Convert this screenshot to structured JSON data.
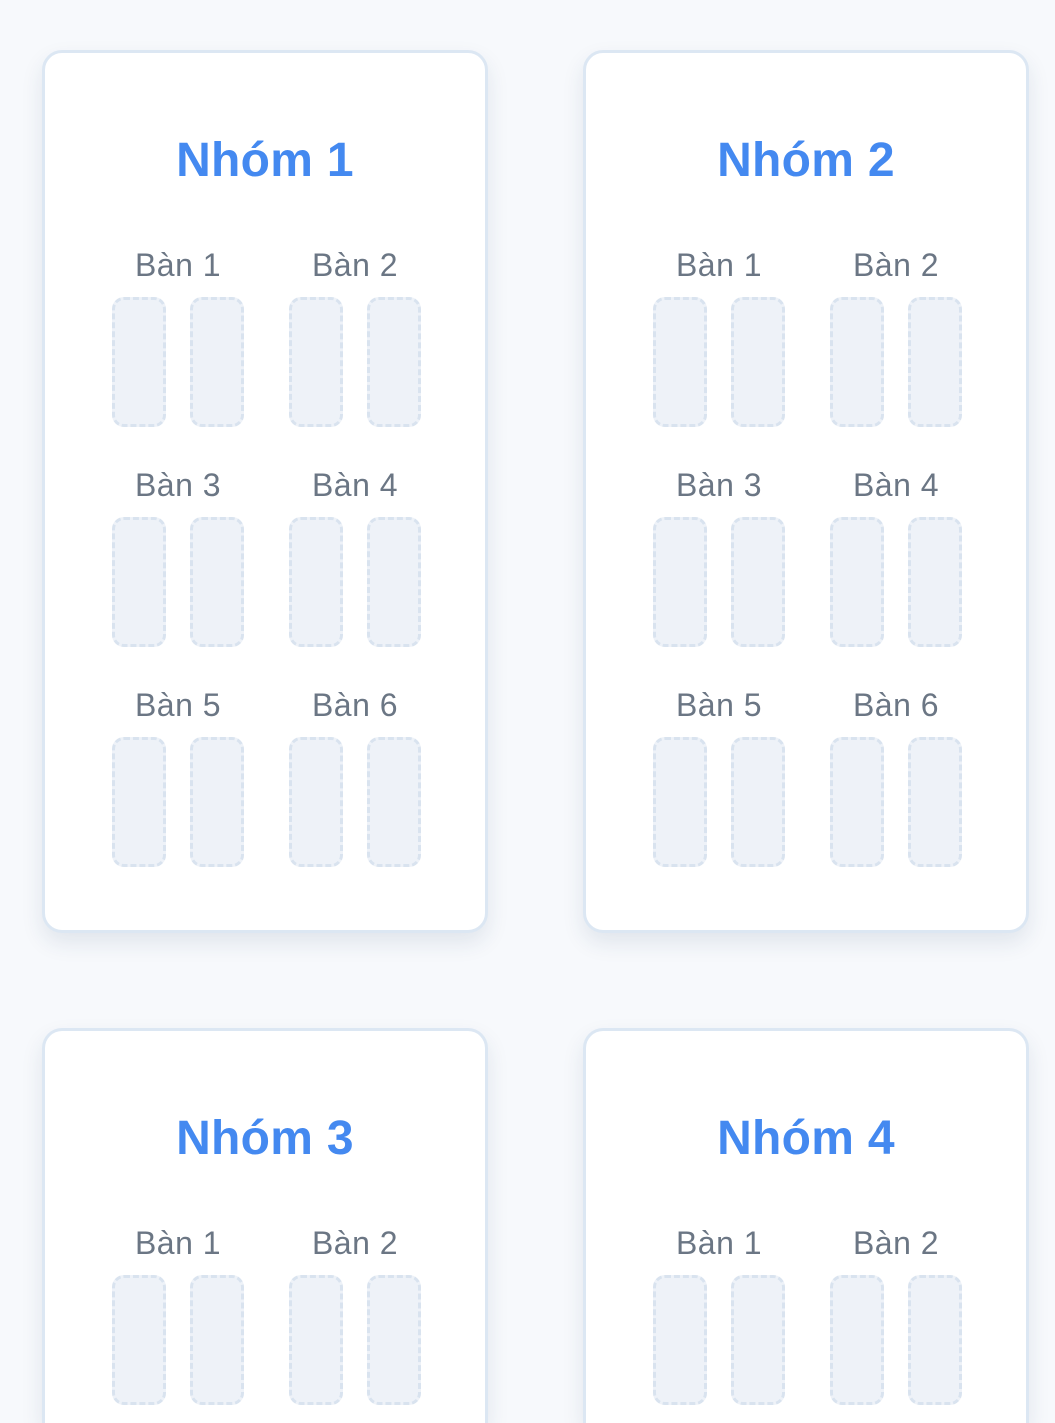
{
  "groups": [
    {
      "title": "Nhóm 1",
      "desks": [
        {
          "label": "Bàn 1"
        },
        {
          "label": "Bàn 2"
        },
        {
          "label": "Bàn 3"
        },
        {
          "label": "Bàn 4"
        },
        {
          "label": "Bàn 5"
        },
        {
          "label": "Bàn 6"
        }
      ]
    },
    {
      "title": "Nhóm 2",
      "desks": [
        {
          "label": "Bàn 1"
        },
        {
          "label": "Bàn 2"
        },
        {
          "label": "Bàn 3"
        },
        {
          "label": "Bàn 4"
        },
        {
          "label": "Bàn 5"
        },
        {
          "label": "Bàn 6"
        }
      ]
    },
    {
      "title": "Nhóm 3",
      "desks": [
        {
          "label": "Bàn 1"
        },
        {
          "label": "Bàn 2"
        }
      ]
    },
    {
      "title": "Nhóm 4",
      "desks": [
        {
          "label": "Bàn 1"
        },
        {
          "label": "Bàn 2"
        }
      ]
    }
  ],
  "colors": {
    "group_title": "#4489f0",
    "desk_label": "#6b7684",
    "seat_fill": "#eef2f8",
    "seat_border": "#d9e3ef",
    "card_border": "#dce7f3",
    "background": "#f7f9fc"
  }
}
